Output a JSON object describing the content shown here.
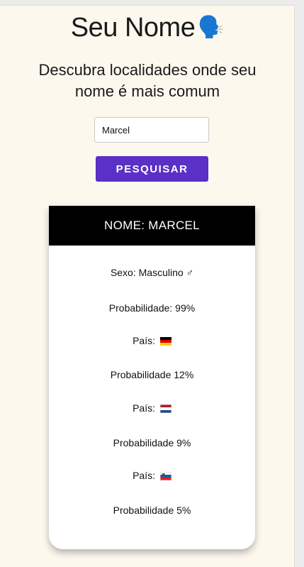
{
  "header": {
    "title": "Seu Nome",
    "title_emoji": "🗣️",
    "subtitle": "Descubra localidades onde seu nome é mais comum"
  },
  "search": {
    "value": "Marcel",
    "button_label": "PESQUISAR"
  },
  "result": {
    "title": "NOME: MARCEL",
    "gender": "Sexo: Masculino ♂",
    "gender_probability": "Probabilidade: 99%",
    "countries": [
      {
        "label": "País:",
        "flag": "germany-flag",
        "probability": "Probabilidade 12%"
      },
      {
        "label": "País:",
        "flag": "netherlands-flag",
        "probability": "Probabilidade 9%"
      },
      {
        "label": "País:",
        "flag": "slovenia-flag",
        "probability": "Probabilidade 5%"
      }
    ]
  },
  "colors": {
    "page_background": "#fdf8ee",
    "button": "#5a30c6",
    "card_header": "#000000"
  }
}
